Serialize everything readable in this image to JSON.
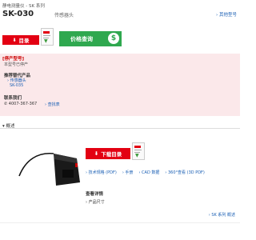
{
  "breadcrumb": "静电测量仪 - SK 系列",
  "product": {
    "model": "SK-030",
    "subtitle": "传感器头"
  },
  "other_models": "其他型号",
  "buttons": {
    "catalog": "目录",
    "price_inquiry": "价格查询",
    "download_catalog": "下载目录"
  },
  "discontinued": {
    "title": "[停产型号]",
    "note": "本型号已停产"
  },
  "recommend": {
    "title": "推荐替代产品",
    "item": "传感器头",
    "model": "SK-035"
  },
  "contact": {
    "title": "联系我们",
    "phone": "4007-367-367",
    "find_store": "查找表"
  },
  "overview_tab": "概述",
  "links": [
    "技术规格 (PDF)",
    "手册",
    "CAD 数据",
    "360°查看 (3D PDF)"
  ],
  "details": {
    "title": "查看详情",
    "dimensions": "产品尺寸"
  },
  "series_overview": "SK 系列 概述",
  "colors": {
    "accent_red": "#e30012",
    "green": "#2fa84f",
    "link": "#1a5fb4",
    "panel": "#fbe8ea"
  },
  "icons": [
    "download-icon",
    "pdf-thumbnail",
    "dollar-coin-icon",
    "phone-icon",
    "arrow-icon"
  ]
}
